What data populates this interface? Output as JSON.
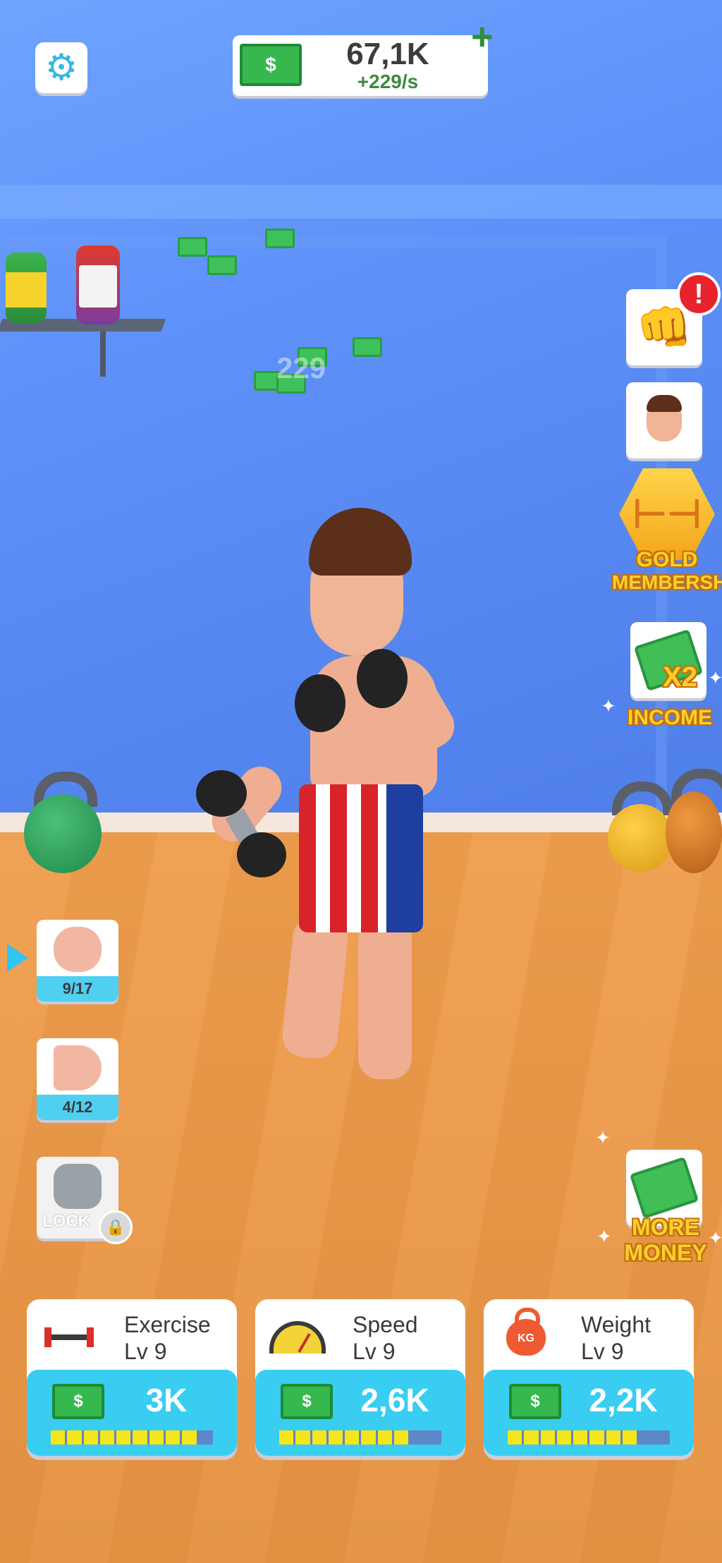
{
  "top": {
    "money_total": "67,1K",
    "money_rate": "+229/s",
    "money_icon": "$",
    "plus_label": "+"
  },
  "floating_income": "229",
  "right_menu": {
    "alert_badge": "!",
    "gold_label_1": "GOLD",
    "gold_label_2": "MEMBERSHIP",
    "income_multiplier": "X2",
    "income_label": "INCOME",
    "more_label_1": "MORE",
    "more_label_2": "MONEY"
  },
  "muscle_groups": [
    {
      "progress": "9/17",
      "selected": true
    },
    {
      "progress": "4/12",
      "selected": false
    },
    {
      "lock_label": "LOCK",
      "locked": true
    }
  ],
  "upgrades": [
    {
      "name": "Exercise",
      "level": "Lv 9",
      "price": "3K",
      "icon": "barbell-icon",
      "filled_segments": 9,
      "total_segments": 10
    },
    {
      "name": "Speed",
      "level": "Lv 9",
      "price": "2,6K",
      "icon": "speedometer-icon",
      "filled_segments": 8,
      "total_segments": 10
    },
    {
      "name": "Weight",
      "level": "Lv 9",
      "price": "2,2K",
      "icon": "kettlebell-icon",
      "kettle_label": "KG",
      "filled_segments": 8,
      "total_segments": 10
    }
  ],
  "colors": {
    "accent_blue": "#39cdf2",
    "money_green": "#37b84f",
    "progress_yellow": "#f7e51b",
    "alert_red": "#e8232e",
    "promo_gold": "#ffcf2f"
  }
}
